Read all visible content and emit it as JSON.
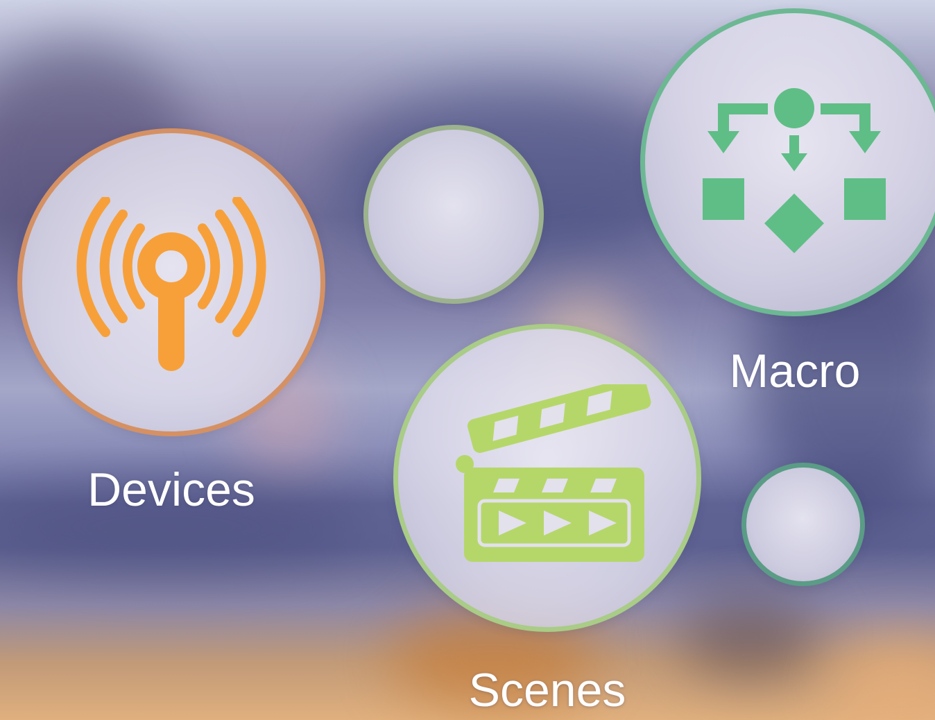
{
  "menu": {
    "devices": {
      "label": "Devices",
      "icon": "antenna-broadcast-icon",
      "color": "#f7a03a",
      "ring": "#d59163"
    },
    "macro": {
      "label": "Macro",
      "icon": "flowchart-icon",
      "color": "#5fbe86",
      "ring": "#6cb893"
    },
    "scenes": {
      "label": "Scenes",
      "icon": "clapperboard-icon",
      "color": "#b5d76a",
      "ring": "#a9cc86"
    }
  },
  "decorative_bubbles": [
    {
      "name": "bubble-small-green",
      "ring": "#9cb38d"
    },
    {
      "name": "bubble-small-teal",
      "ring": "#5a9c86"
    }
  ]
}
